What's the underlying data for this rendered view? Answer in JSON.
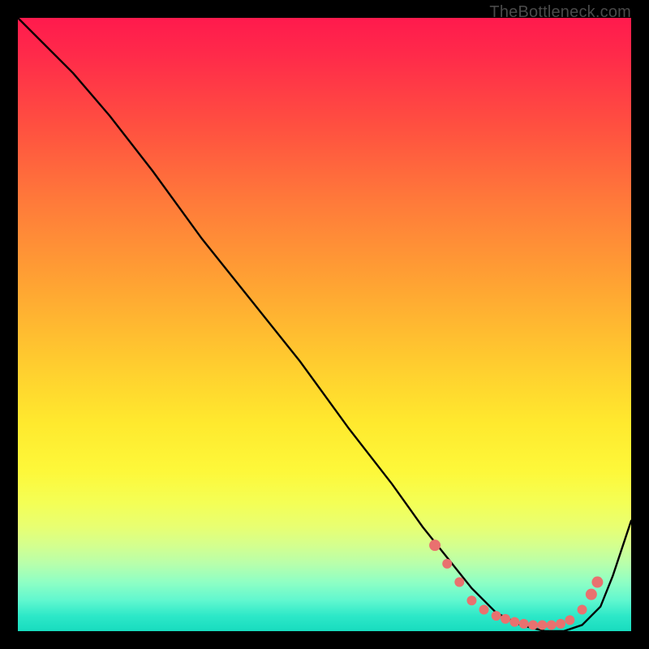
{
  "attribution": "TheBottleneck.com",
  "chart_data": {
    "type": "line",
    "title": "",
    "xlabel": "",
    "ylabel": "",
    "xlim": [
      0,
      100
    ],
    "ylim": [
      0,
      100
    ],
    "series": [
      {
        "name": "curve",
        "x": [
          0,
          4,
          9,
          15,
          22,
          30,
          38,
          46,
          54,
          61,
          66,
          70,
          74,
          78,
          82,
          86,
          89,
          92,
          95,
          97,
          100
        ],
        "y": [
          100,
          96,
          91,
          84,
          75,
          64,
          54,
          44,
          33,
          24,
          17,
          12,
          7,
          3,
          1,
          0,
          0,
          1,
          4,
          9,
          18
        ]
      }
    ],
    "markers": {
      "comment": "highlighted points near curve minimum",
      "color": "#e9716f",
      "points": [
        {
          "x": 68,
          "y": 14
        },
        {
          "x": 70,
          "y": 11
        },
        {
          "x": 72,
          "y": 8
        },
        {
          "x": 74,
          "y": 5
        },
        {
          "x": 76,
          "y": 3.5
        },
        {
          "x": 78,
          "y": 2.5
        },
        {
          "x": 79.5,
          "y": 2
        },
        {
          "x": 81,
          "y": 1.5
        },
        {
          "x": 82.5,
          "y": 1.2
        },
        {
          "x": 84,
          "y": 1
        },
        {
          "x": 85.5,
          "y": 1
        },
        {
          "x": 87,
          "y": 1
        },
        {
          "x": 88.5,
          "y": 1.2
        },
        {
          "x": 90,
          "y": 1.8
        },
        {
          "x": 92,
          "y": 3.5
        },
        {
          "x": 93.5,
          "y": 6
        },
        {
          "x": 94.5,
          "y": 8
        }
      ]
    }
  }
}
